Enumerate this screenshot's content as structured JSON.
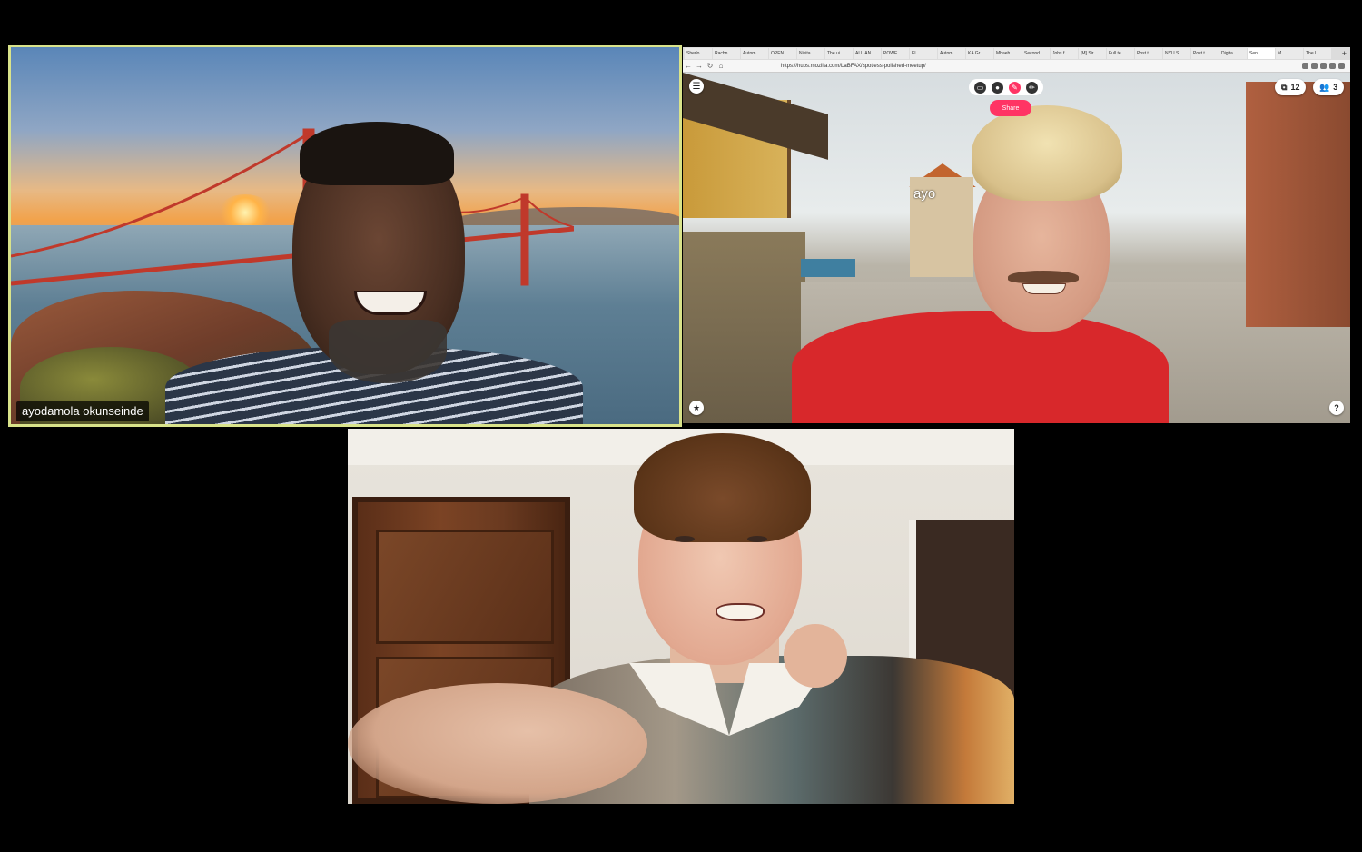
{
  "tiles": [
    {
      "participant_name": "ayodamola okunseinde"
    }
  ],
  "browser": {
    "tabs": [
      "Sherlo",
      "Rachn",
      "Autom",
      "OPEN",
      "Nikita",
      "The ui",
      "ALLIAN",
      "POWE",
      "El",
      "Autom",
      "KA Gr",
      "Mhaeh",
      "Second",
      "Jobs f",
      "[M] Sir",
      "Full te",
      "Post t",
      "NYU S",
      "Post t",
      "Digita",
      "Sen",
      "M",
      "The Li"
    ],
    "new_tab_icon": "+",
    "url": "https://hubs.mozilla.com/LaBFAX/spotless-polished-meetup/"
  },
  "hubs": {
    "avatar_label": "ayo",
    "share_label": "Share",
    "objects_count": "12",
    "people_count": "3",
    "help_label": "?",
    "icons": [
      "menu-icon",
      "camera-icon",
      "microphone-icon",
      "pen-icon",
      "pencil-icon",
      "objects-icon",
      "people-icon",
      "star-icon",
      "help-icon"
    ]
  },
  "colors": {
    "active_speaker_border": "#d9e38a",
    "hubs_accent": "#ff3464",
    "background": "#000000"
  }
}
